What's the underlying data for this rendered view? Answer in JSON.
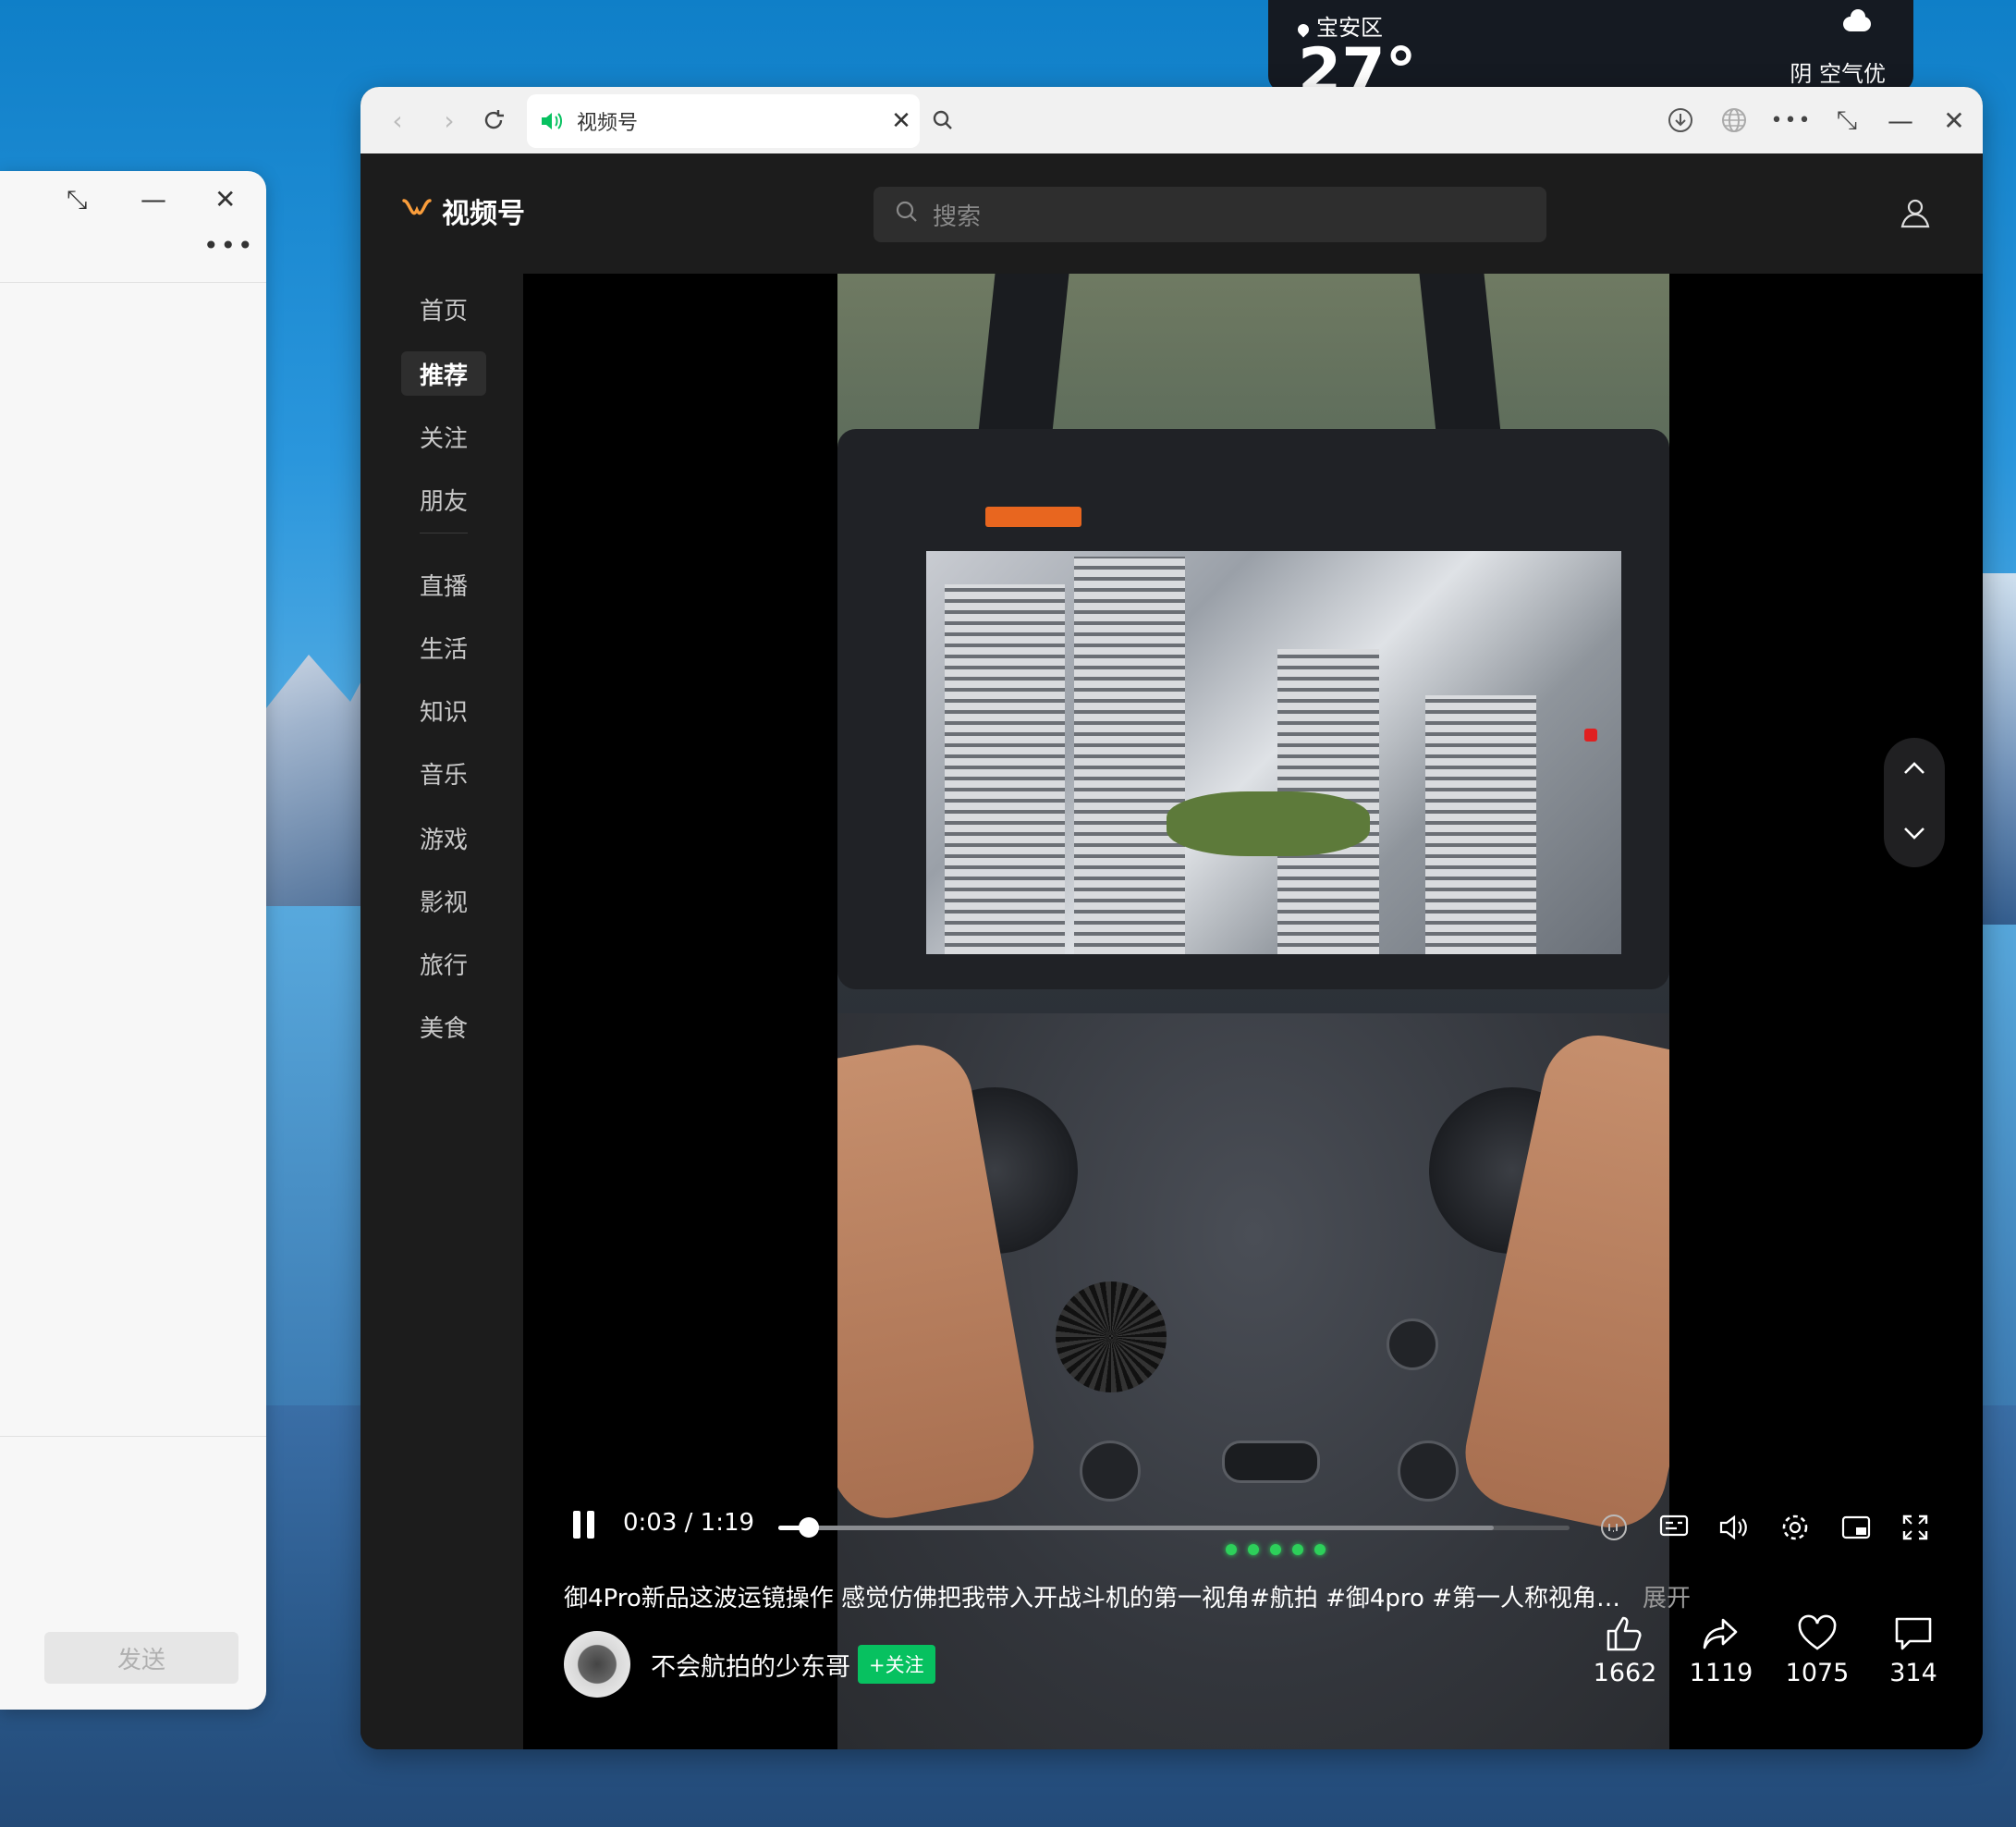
{
  "weather": {
    "location": "宝安区",
    "temperature": "27°",
    "condition": "阴  空气优"
  },
  "left_window": {
    "send_label": "发送"
  },
  "browser": {
    "tab": {
      "title": "视频号"
    }
  },
  "app": {
    "brand": "视频号",
    "search_placeholder": "搜索",
    "nav": [
      {
        "label": "首页"
      },
      {
        "label": "推荐"
      },
      {
        "label": "关注"
      },
      {
        "label": "朋友"
      },
      {
        "label": "直播"
      },
      {
        "label": "生活"
      },
      {
        "label": "知识"
      },
      {
        "label": "音乐"
      },
      {
        "label": "游戏"
      },
      {
        "label": "影视"
      },
      {
        "label": "旅行"
      },
      {
        "label": "美食"
      }
    ],
    "active_nav": "推荐",
    "player": {
      "time": "0:03 / 1:19",
      "progress_fraction": 0.038,
      "caption": "御4Pro新品这波运镜操作 感觉仿佛把我带入开战斗机的第一视角#航拍 #御4pro #第一人称视角…",
      "expand_label": "展开",
      "author": "不会航拍的少东哥",
      "follow_label": "+关注",
      "stats": {
        "likes": "1662",
        "shares": "1119",
        "favorites": "1075",
        "comments": "314"
      }
    }
  },
  "colors": {
    "accent_green": "#07c160",
    "logo_orange": "#fa9d3b",
    "background_dark": "#1c1c1c"
  }
}
